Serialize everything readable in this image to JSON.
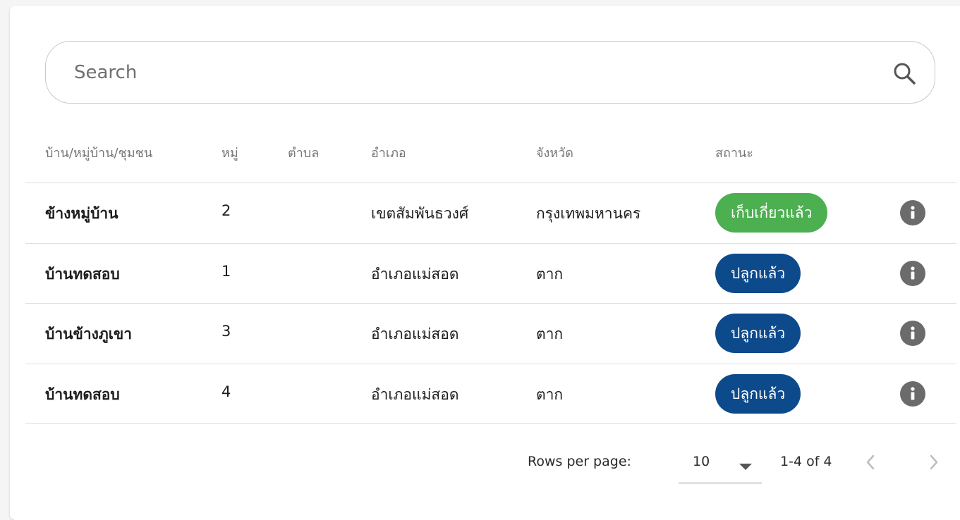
{
  "search": {
    "placeholder": "Search"
  },
  "table": {
    "headers": [
      "บ้าน/หมู่บ้าน/ชุมชน",
      "หมู่",
      "ตำบล",
      "อำเภอ",
      "จังหวัด",
      "สถานะ"
    ],
    "rows": [
      {
        "village": "ข้างหมู่บ้าน",
        "moo": "2",
        "tambon": "",
        "amphoe": "เขตสัมพันธวงศ์",
        "province": "กรุงเทพมหานคร",
        "status": "เก็บเกี่ยวแล้ว",
        "status_color": "#4caf50"
      },
      {
        "village": "บ้านทดสอบ",
        "moo": "1",
        "tambon": "",
        "amphoe": "อำเภอแม่สอด",
        "province": "ตาก",
        "status": "ปลูกแล้ว",
        "status_color": "#0d4a8c"
      },
      {
        "village": "บ้านข้างภูเขา",
        "moo": "3",
        "tambon": "",
        "amphoe": "อำเภอแม่สอด",
        "province": "ตาก",
        "status": "ปลูกแล้ว",
        "status_color": "#0d4a8c"
      },
      {
        "village": "บ้านทดสอบ",
        "moo": "4",
        "tambon": "",
        "amphoe": "อำเภอแม่สอด",
        "province": "ตาก",
        "status": "ปลูกแล้ว",
        "status_color": "#0d4a8c"
      }
    ]
  },
  "pagination": {
    "rows_per_page_label": "Rows per page:",
    "rows_per_page_value": "10",
    "range": "1-4 of 4"
  },
  "colors": {
    "harvested": "#4caf50",
    "planted": "#0d4a8c",
    "info_icon": "#6b6b6b"
  },
  "icons": {
    "search": "search-icon",
    "info": "info-icon",
    "dropdown": "caret-down-icon",
    "prev": "chevron-left-icon",
    "next": "chevron-right-icon"
  }
}
